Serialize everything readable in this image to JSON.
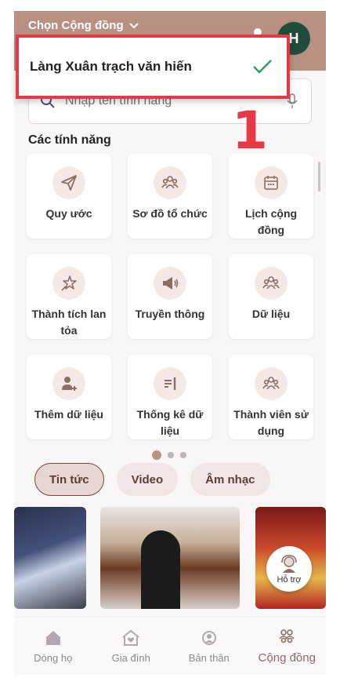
{
  "header": {
    "title": "Chọn Cộng đồng",
    "avatar_letter": "H"
  },
  "dropdown": {
    "selected": "Làng Xuân trạch văn hiến"
  },
  "annotation": {
    "number": "1"
  },
  "search": {
    "placeholder": "Nhập tên tính năng"
  },
  "features": {
    "title": "Các tính năng",
    "items": [
      {
        "label": "Quy ước",
        "icon": "paper-plane-icon"
      },
      {
        "label": "Sơ đồ tổ chức",
        "icon": "people-group-icon"
      },
      {
        "label": "Lịch cộng đồng",
        "icon": "calendar-icon"
      },
      {
        "label": "Thành tích lan tỏa",
        "icon": "star-icon"
      },
      {
        "label": "Truyền thông",
        "icon": "megaphone-icon"
      },
      {
        "label": "Dữ liệu",
        "icon": "people-group-icon"
      },
      {
        "label": "Thêm dữ liệu",
        "icon": "add-user-icon"
      },
      {
        "label": "Thống kê dữ liệu",
        "icon": "statistics-icon"
      },
      {
        "label": "Thành viên sử dụng",
        "icon": "people-group-icon"
      }
    ]
  },
  "tabs": [
    {
      "label": "Tin tức",
      "active": true
    },
    {
      "label": "Video",
      "active": false
    },
    {
      "label": "Âm nhạc",
      "active": false
    }
  ],
  "help": {
    "label": "Hỗ trợ"
  },
  "bottom_nav": [
    {
      "label": "Dòng họ",
      "icon": "home-icon"
    },
    {
      "label": "Gia đình",
      "icon": "family-home-icon"
    },
    {
      "label": "Bản thân",
      "icon": "self-icon"
    },
    {
      "label": "Cộng đồng",
      "icon": "community-icon",
      "active": true
    }
  ],
  "colors": {
    "accent": "#b89182",
    "highlight": "#e53945",
    "check": "#2e9e5e"
  }
}
